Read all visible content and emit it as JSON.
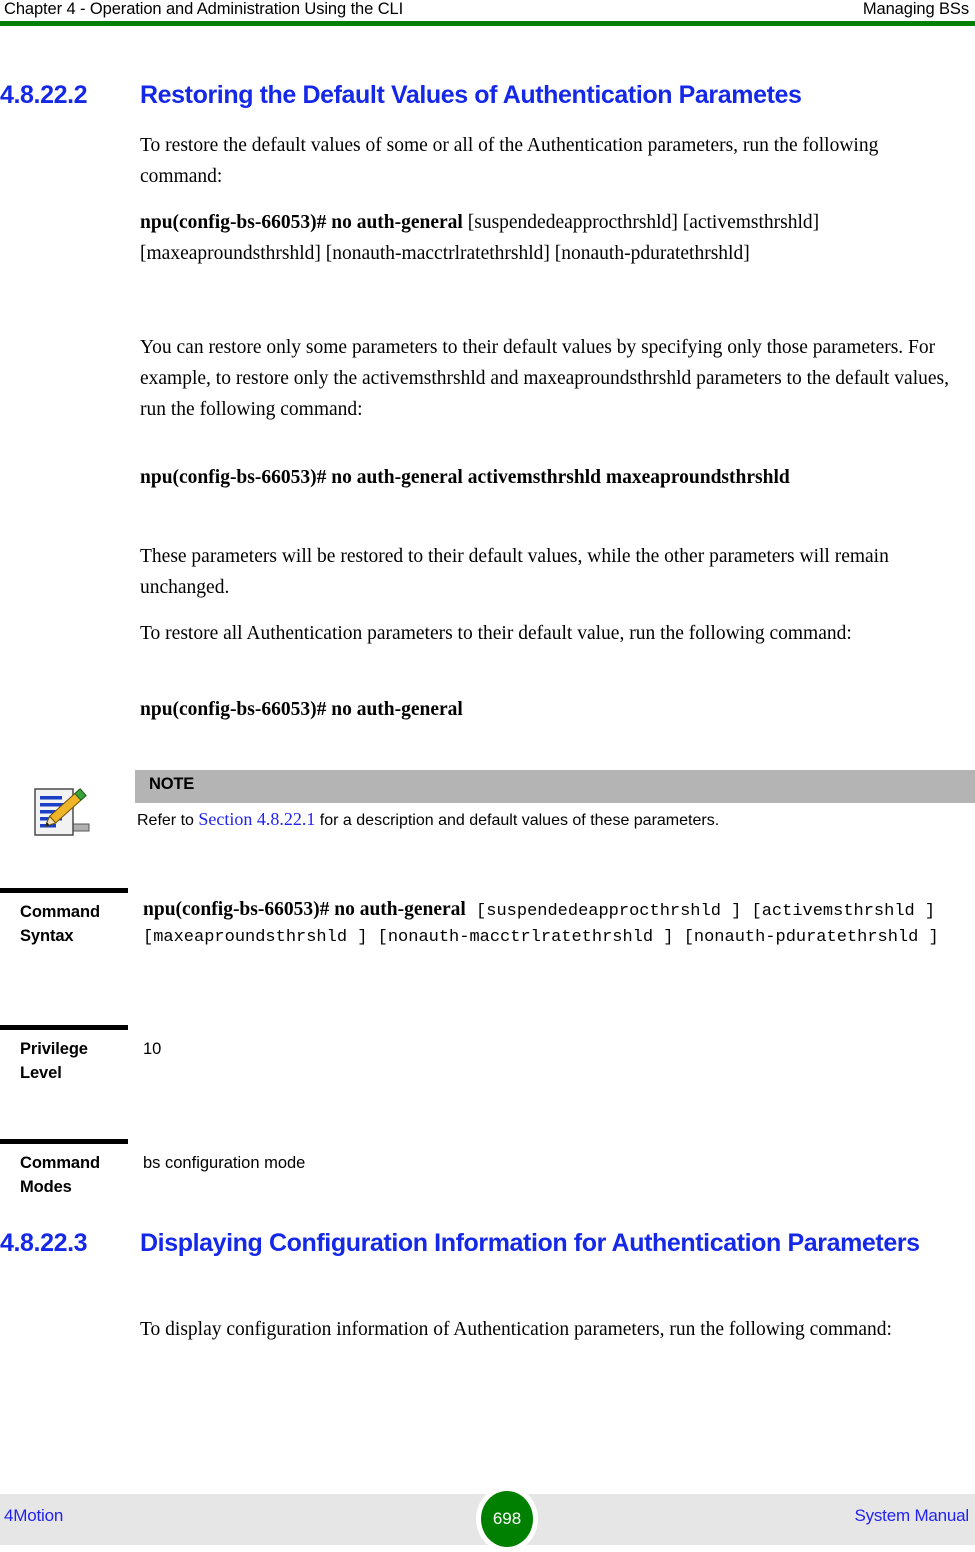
{
  "header": {
    "left": "Chapter 4 - Operation and Administration Using the CLI",
    "right": "Managing BSs",
    "rule_color": "#008000"
  },
  "section_1": {
    "number": "4.8.22.2",
    "title": "Restoring the Default Values of Authentication Parametes",
    "color": "#1528e8",
    "paragraphs": [
      "To restore the default values of some or all of the Authentication parameters, run the following command:",
      "You can restore only some parameters to their default values by specifying only those parameters. For example, to restore only the activemsthrshld and maxeaproundsthrshld parameters to the default values, run the following command:",
      "These parameters will be restored to their default values, while the other parameters will remain unchanged.",
      "To restore all Authentication parameters to their default value, run the following command:"
    ],
    "command_1_bold": "npu(config-bs-66053)# no auth-general",
    "command_1_args": " [suspendedeapprocthrshld] [activemsthrshld] [maxeaproundsthrshld] [nonauth-macctrlratethrshld] [nonauth-pduratethrshld]",
    "command_2_bold": "npu(config-bs-66053)# no auth-general activemsthrshld maxeaproundsthrshld",
    "command_3_bold": "npu(config-bs-66053)# no auth-general"
  },
  "note": {
    "icon": "note-pencil-icon",
    "bar_label": "NOTE",
    "bar_color": "#b4b4b4",
    "text_before": "Refer to ",
    "link": "Section 4.8.22.1",
    "link_color": "#2222ee",
    "text_after": " for a description and default values of these parameters."
  },
  "command_table": {
    "rows": [
      {
        "label": "Command Syntax",
        "label_lines": [
          "Command",
          "Syntax"
        ],
        "value_bold": "npu(config-bs-66053)# no auth-general",
        "value_mono": " [suspendedeapprocthrshld ] [activemsthrshld ] [maxeaproundsthrshld ] [nonauth-macctrlratethrshld ] [nonauth-pduratethrshld ]"
      },
      {
        "label": "Privilege Level",
        "label_lines": [
          "Privilege",
          "Level"
        ],
        "value": "10"
      },
      {
        "label": "Command Modes",
        "label_lines": [
          "Command",
          "Modes"
        ],
        "value": "bs configuration mode"
      }
    ]
  },
  "section_2": {
    "number": "4.8.22.3",
    "title": "Displaying Configuration Information for Authentication Parameters",
    "color": "#1528e8",
    "paragraph": "To display configuration information of Authentication parameters, run the following command:"
  },
  "footer": {
    "left": "4Motion",
    "page": "698",
    "right": "System Manual",
    "page_badge_color": "#008000",
    "background": "#e6e6e6"
  }
}
